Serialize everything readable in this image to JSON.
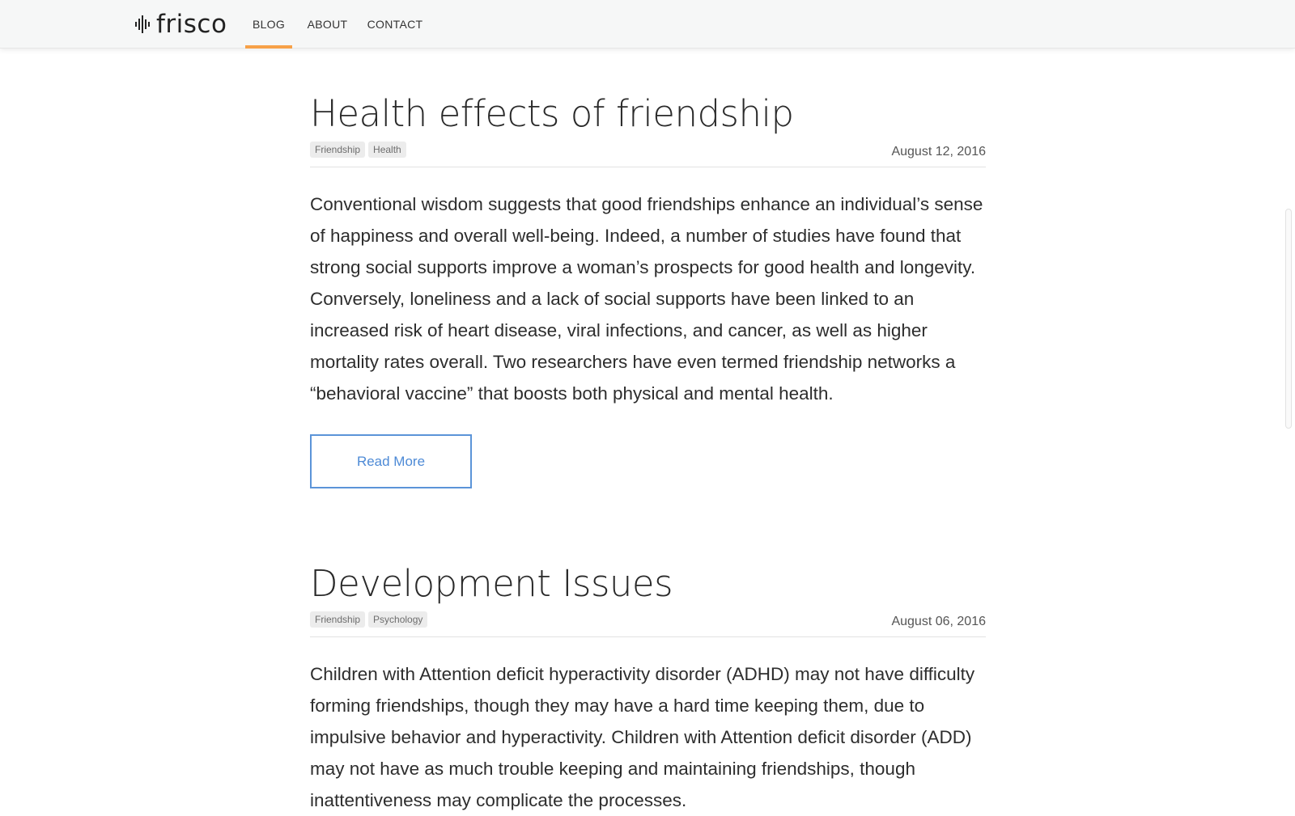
{
  "site": {
    "logo_text": "frisco",
    "logo_icon": "waveform-icon",
    "accent_color": "#f7a148",
    "link_color": "#4d8ad6"
  },
  "nav": {
    "items": [
      {
        "label": "BLOG",
        "active": true
      },
      {
        "label": "ABOUT",
        "active": false
      },
      {
        "label": "CONTACT",
        "active": false
      }
    ]
  },
  "posts": [
    {
      "title": "Health effects of friendship",
      "tags": [
        "Friendship",
        "Health"
      ],
      "date": "August 12, 2016",
      "excerpt": "Conventional wisdom suggests that good friendships enhance an individual’s sense of happiness and overall well-being. Indeed, a number of studies have found that strong social supports improve a woman’s prospects for good health and longevity. Conversely, loneliness and a lack of social supports have been linked to an increased risk of heart disease, viral infections, and cancer, as well as higher mortality rates overall. Two researchers have even termed friendship networks a “behavioral vaccine” that boosts both physical and mental health.",
      "read_more_label": "Read More"
    },
    {
      "title": "Development Issues",
      "tags": [
        "Friendship",
        "Psychology"
      ],
      "date": "August 06, 2016",
      "excerpt": "Children with Attention deficit hyperactivity disorder (ADHD) may not have difficulty forming friendships, though they may have a hard time keeping them, due to impulsive behavior and hyperactivity. Children with Attention deficit disorder (ADD) may not have as much trouble keeping and maintaining friendships, though inattentiveness may complicate the processes."
    }
  ]
}
